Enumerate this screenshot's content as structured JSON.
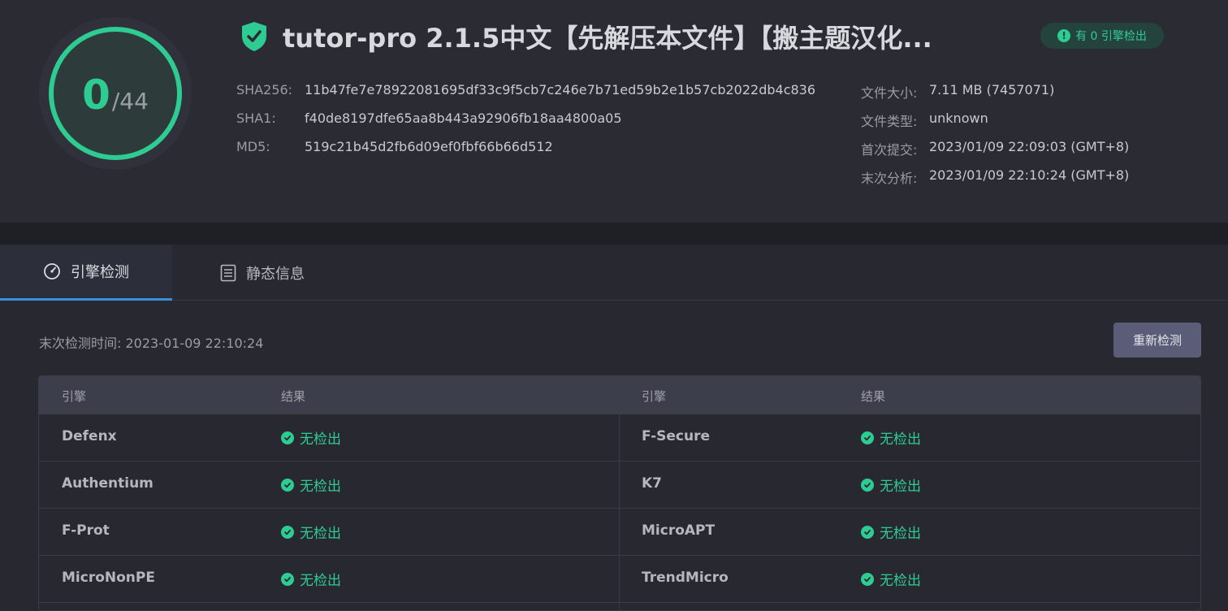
{
  "score": {
    "detected": "0",
    "total": "/44"
  },
  "file": {
    "title": "tutor-pro 2.1.5中文【先解压本文件】【搬主题汉化..."
  },
  "badge": {
    "text": "有 0 引擎检出"
  },
  "hashes": [
    {
      "label": "SHA256:",
      "value": "11b47fe7e78922081695df33c9f5cb7c246e7b71ed59b2e1b57cb2022db4c836"
    },
    {
      "label": "SHA1:",
      "value": "f40de8197dfe65aa8b443a92906fb18aa4800a05"
    },
    {
      "label": "MD5:",
      "value": "519c21b45d2fb6d09ef0fbf66b66d512"
    }
  ],
  "meta": [
    {
      "label": "文件大小:",
      "value": "7.11 MB (7457071)"
    },
    {
      "label": "文件类型:",
      "value": "unknown"
    },
    {
      "label": "首次提交:",
      "value": "2023/01/09 22:09:03 (GMT+8)"
    },
    {
      "label": "末次分析:",
      "value": "2023/01/09 22:10:24 (GMT+8)"
    }
  ],
  "tabs": [
    {
      "label": "引擎检测",
      "icon": "gauge-icon",
      "active": true
    },
    {
      "label": "静态信息",
      "icon": "list-icon",
      "active": false
    }
  ],
  "detection": {
    "last_check": "末次检测时间: 2023-01-09 22:10:24",
    "recheck_label": "重新检测"
  },
  "table": {
    "headers": [
      "引擎",
      "结果",
      "引擎",
      "结果"
    ],
    "rows": [
      {
        "left": {
          "engine": "Defenx",
          "result": "无检出"
        },
        "right": {
          "engine": "F-Secure",
          "result": "无检出"
        }
      },
      {
        "left": {
          "engine": "Authentium",
          "result": "无检出"
        },
        "right": {
          "engine": "K7",
          "result": "无检出"
        }
      },
      {
        "left": {
          "engine": "F-Prot",
          "result": "无检出"
        },
        "right": {
          "engine": "MicroAPT",
          "result": "无检出"
        }
      },
      {
        "left": {
          "engine": "MicroNonPE",
          "result": "无检出"
        },
        "right": {
          "engine": "TrendMicro",
          "result": "无检出"
        }
      }
    ]
  },
  "colors": {
    "accent_green": "#2ecc93",
    "tab_active": "#3a8fd9",
    "button": "#5a5c78"
  }
}
